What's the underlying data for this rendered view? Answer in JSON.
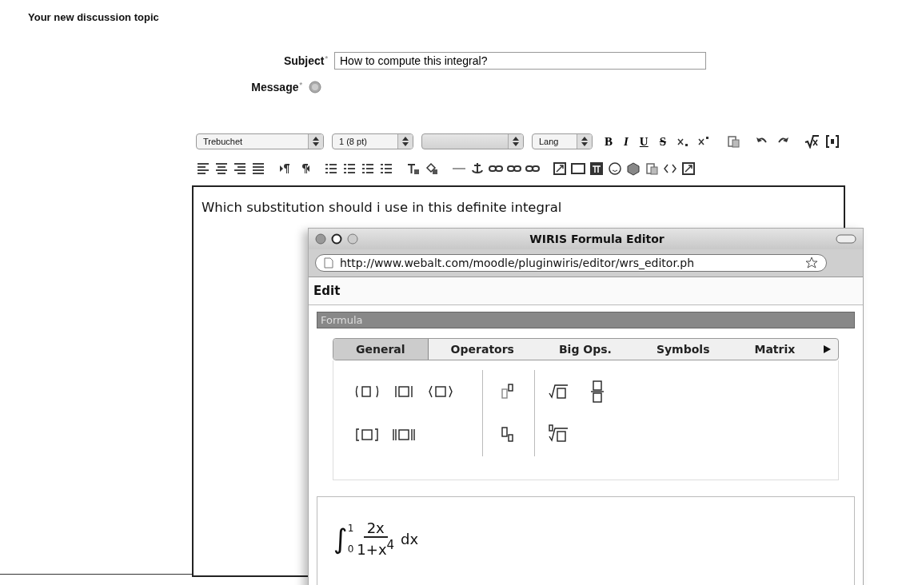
{
  "heading": "Your new discussion topic",
  "subject": {
    "label": "Subject",
    "required_mark": "*",
    "value": "How to compute this integral?"
  },
  "message": {
    "label": "Message",
    "required_mark": "*"
  },
  "toolbar": {
    "selects": [
      {
        "value": "Trebuchet"
      },
      {
        "value": "1 (8 pt)"
      },
      {
        "kind": "blank"
      },
      {
        "value": "Lang"
      }
    ],
    "format_buttons": [
      "B",
      "I",
      "U",
      "S"
    ]
  },
  "editor": {
    "text": "Which substitution should i use in this definite integral"
  },
  "popup": {
    "title": "WIRIS Formula Editor",
    "url": "http://www.webalt.com/moodle/pluginwiris/editor/wrs_editor.ph",
    "menu": [
      "Edit"
    ],
    "panel_title": "Formula",
    "tabs": [
      {
        "label": "General",
        "selected": true
      },
      {
        "label": "Operators",
        "selected": false
      },
      {
        "label": "Big Ops.",
        "selected": false
      },
      {
        "label": "Symbols",
        "selected": false
      },
      {
        "label": "Matrix",
        "selected": false
      }
    ],
    "formula": {
      "integral": "∫",
      "upper": "1",
      "lower": "0",
      "numerator": "2x",
      "denominator": "1+x$^{4}$",
      "differential": "dx"
    }
  }
}
